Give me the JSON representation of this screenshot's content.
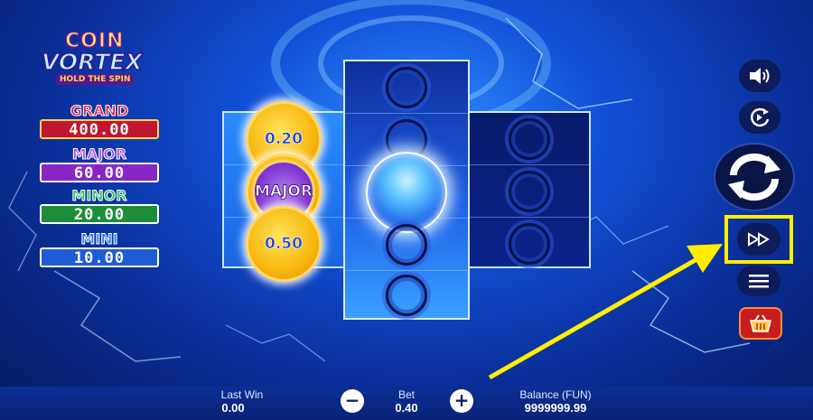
{
  "logo": {
    "line1": "COIN",
    "line2": "VORTEX",
    "line3": "HOLD THE SPIN"
  },
  "jackpots": [
    {
      "label": "GRAND",
      "value": "400.00",
      "label_color": "#e8204a",
      "bg": "#c0162f"
    },
    {
      "label": "MAJOR",
      "value": "60.00",
      "label_color": "#b34ce0",
      "bg": "#8726c4"
    },
    {
      "label": "MINOR",
      "value": "20.00",
      "label_color": "#2fc25a",
      "bg": "#1d8d39"
    },
    {
      "label": "MINI",
      "value": "10.00",
      "label_color": "#2f7df0",
      "bg": "#1f5bd6"
    }
  ],
  "reels": {
    "left": {
      "coins": [
        "0.20",
        "MAJOR",
        "0.50"
      ]
    }
  },
  "controls": {
    "sound_icon": "speaker-icon",
    "autoplay_icon": "autoplay-icon",
    "spin_icon": "spin-arrows-icon",
    "turbo_icon": "fast-forward-icon",
    "menu_icon": "hamburger-icon",
    "shop_icon": "basket-icon"
  },
  "bottom_bar": {
    "last_win_label": "Last Win",
    "last_win_value": "0.00",
    "bet_label": "Bet",
    "bet_value": "0.40",
    "balance_label": "Balance (FUN)",
    "balance_value": "9999999.99",
    "minus": "−",
    "plus": "+"
  },
  "annotation": {
    "color": "#ffee00"
  }
}
